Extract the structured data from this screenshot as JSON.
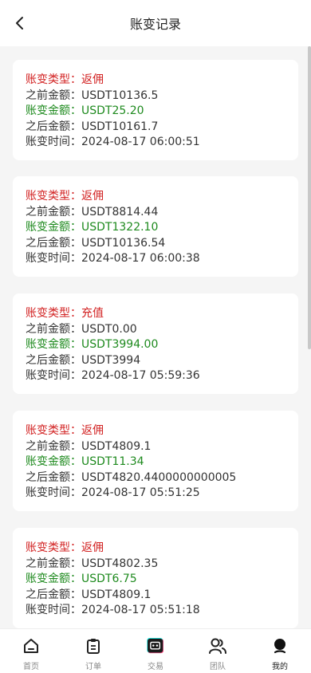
{
  "header": {
    "title": "账变记录"
  },
  "labels": {
    "type": "账变类型：",
    "before": "之前金额：",
    "delta": "账变金额：",
    "after": "之后金额：",
    "time": "账变时间："
  },
  "records": [
    {
      "type": "返佣",
      "before": "USDT10136.5",
      "delta": "USDT25.20",
      "after": "USDT10161.7",
      "time": "2024-08-17 06:00:51"
    },
    {
      "type": "返佣",
      "before": "USDT8814.44",
      "delta": "USDT1322.10",
      "after": "USDT10136.54",
      "time": "2024-08-17 06:00:38"
    },
    {
      "type": "充值",
      "before": "USDT0.00",
      "delta": "USDT3994.00",
      "after": "USDT3994",
      "time": "2024-08-17 05:59:36"
    },
    {
      "type": "返佣",
      "before": "USDT4809.1",
      "delta": "USDT11.34",
      "after": "USDT4820.4400000000005",
      "time": "2024-08-17 05:51:25"
    },
    {
      "type": "返佣",
      "before": "USDT4802.35",
      "delta": "USDT6.75",
      "after": "USDT4809.1",
      "time": "2024-08-17 05:51:18"
    }
  ],
  "tabs": [
    {
      "label": "首页",
      "icon": "home-icon"
    },
    {
      "label": "订单",
      "icon": "clipboard-icon"
    },
    {
      "label": "交易",
      "icon": "robot-icon"
    },
    {
      "label": "团队",
      "icon": "team-icon"
    },
    {
      "label": "我的",
      "icon": "user-icon"
    }
  ],
  "colors": {
    "type": "#d22222",
    "delta": "#1e8a1e",
    "background": "#f5f5f5"
  }
}
